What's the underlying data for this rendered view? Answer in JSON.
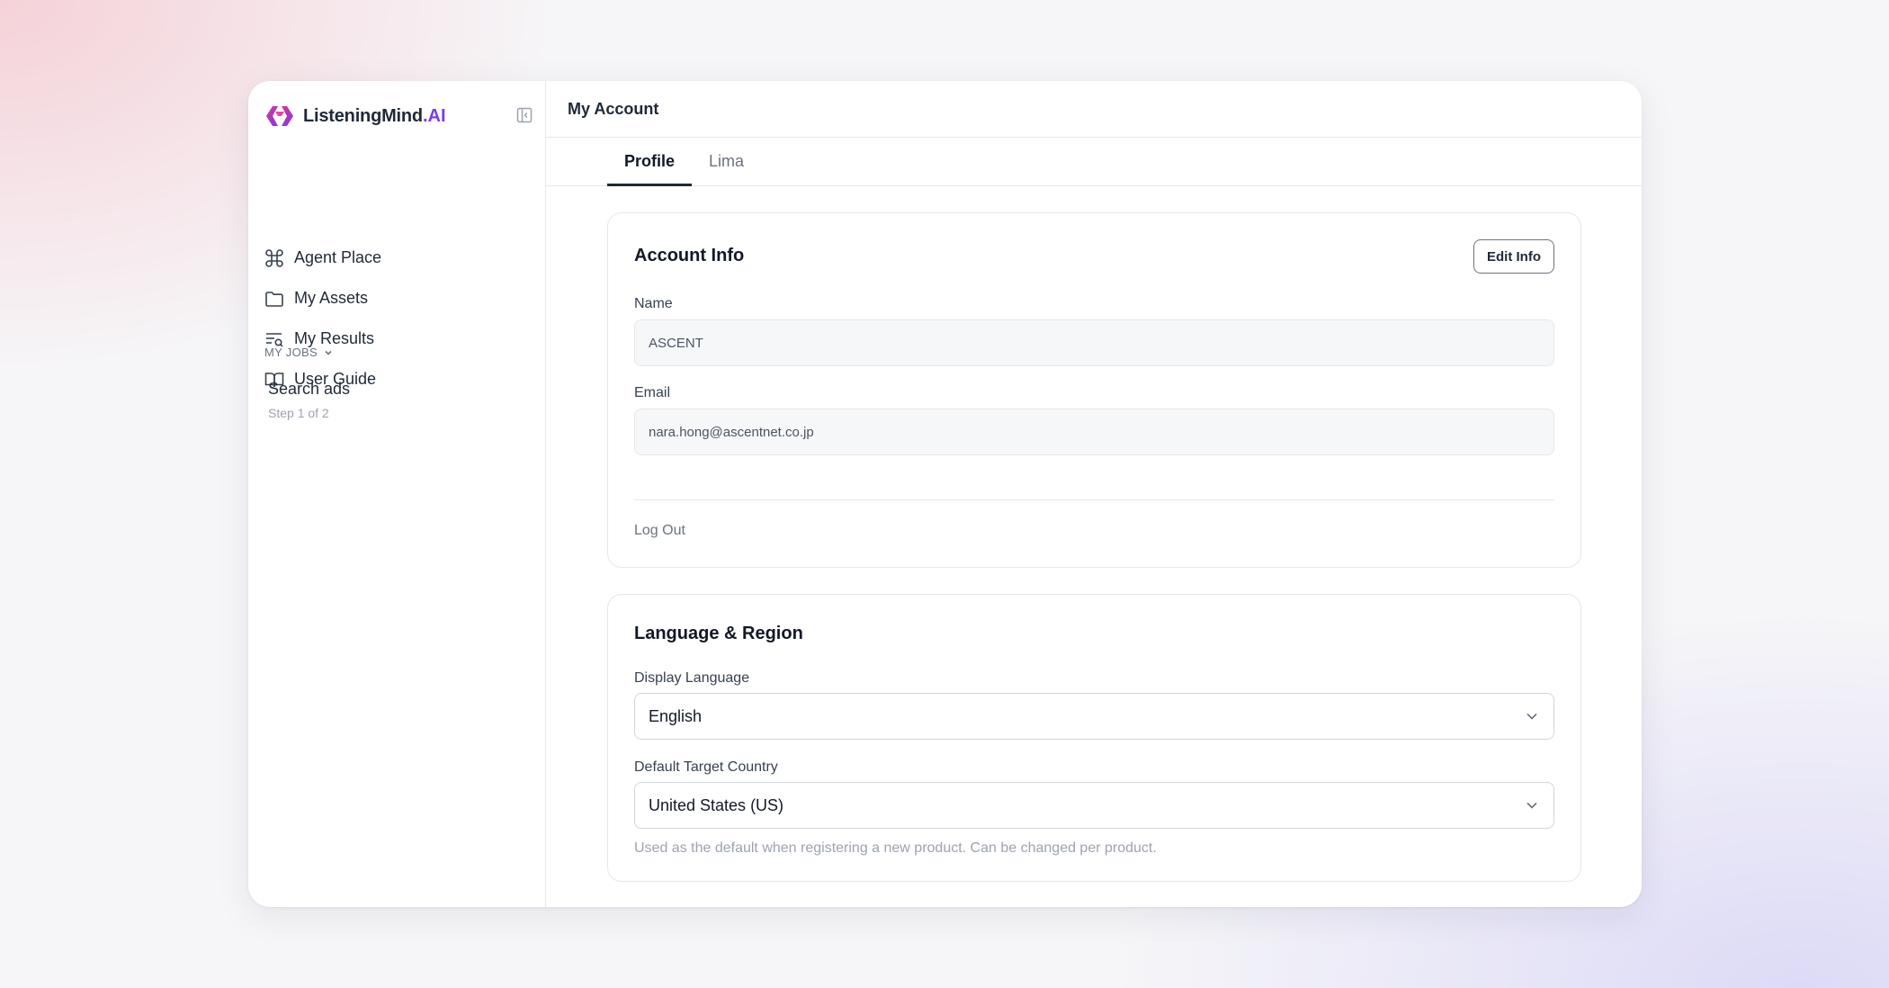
{
  "brand": {
    "name": "ListeningMind",
    "suffix": ".AI"
  },
  "sidebar": {
    "items": [
      {
        "label": "Agent Place",
        "icon": "command-icon"
      },
      {
        "label": "My Assets",
        "icon": "folder-icon"
      },
      {
        "label": "My Results",
        "icon": "list-search-icon"
      },
      {
        "label": "User Guide",
        "icon": "book-open-icon"
      }
    ],
    "jobs_header": "MY JOBS",
    "jobs": [
      {
        "title": "Search ads",
        "subtitle": "Step 1 of 2"
      }
    ]
  },
  "header": {
    "title": "My Account"
  },
  "tabs": [
    {
      "label": "Profile",
      "active": true
    },
    {
      "label": "Lima",
      "active": false
    }
  ],
  "account_info": {
    "title": "Account Info",
    "edit_label": "Edit Info",
    "name_label": "Name",
    "name_value": "ASCENT",
    "email_label": "Email",
    "email_value": "nara.hong@ascentnet.co.jp",
    "logout_label": "Log Out"
  },
  "language_region": {
    "title": "Language & Region",
    "display_language_label": "Display Language",
    "display_language_value": "English",
    "target_country_label": "Default Target Country",
    "target_country_value": "United States (US)",
    "hint": "Used as the default when registering a new product. Can be changed per product."
  },
  "colors": {
    "accent": "#7c3aed",
    "logo_pink": "#e0338f",
    "logo_purple": "#7c3aed",
    "text": "#1f2937",
    "muted": "#6b7280",
    "border": "#e5e7eb"
  }
}
